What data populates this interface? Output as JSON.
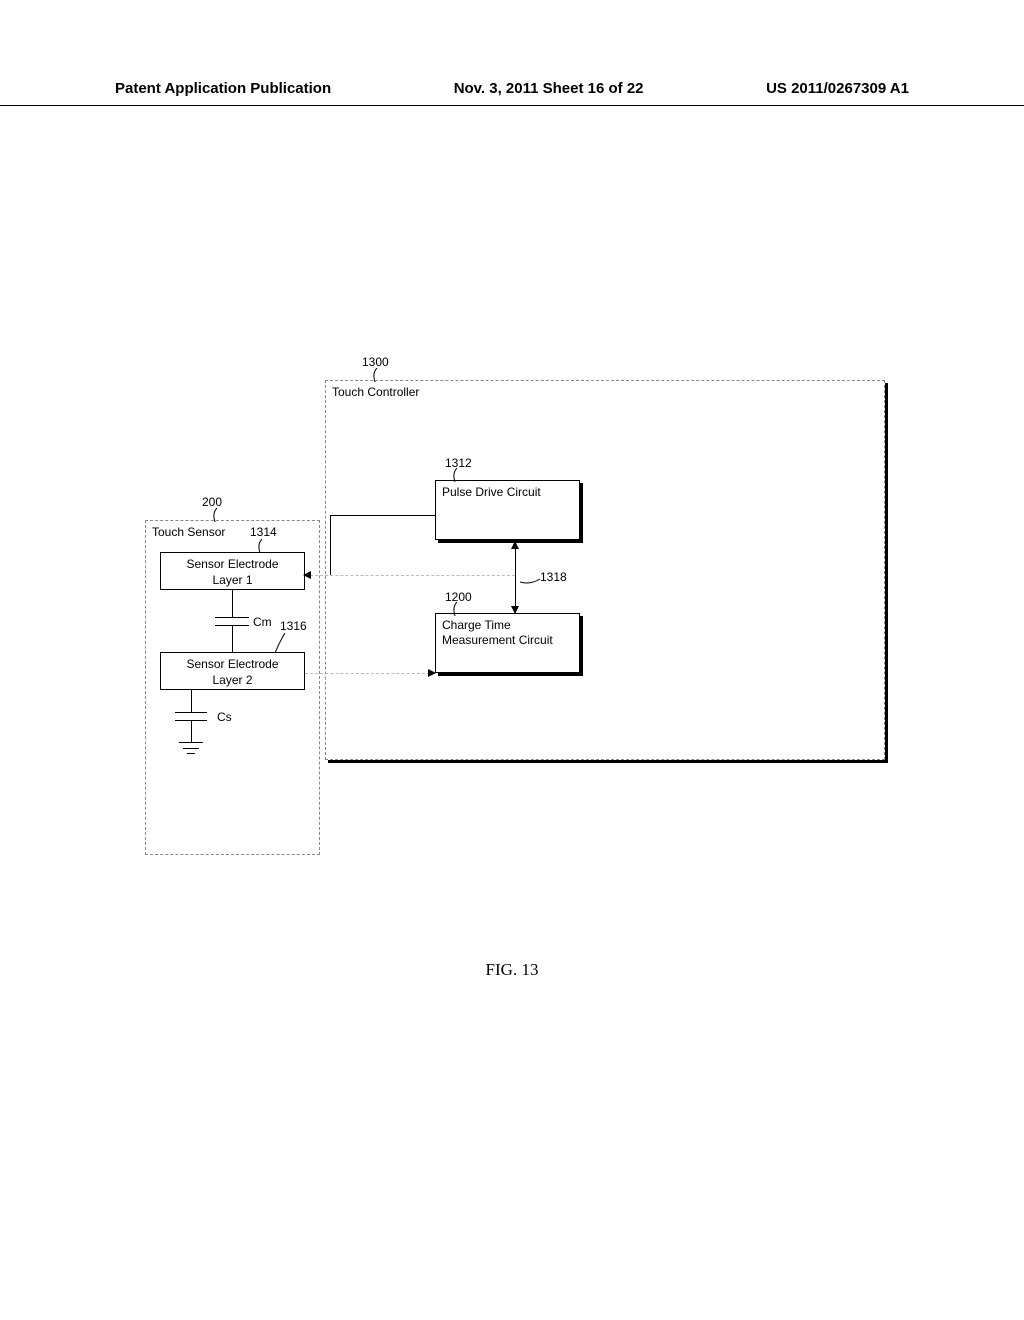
{
  "header": {
    "left": "Patent Application Publication",
    "center": "Nov. 3, 2011   Sheet 16 of 22",
    "right": "US 2011/0267309 A1"
  },
  "figure_label": "FIG. 13",
  "refs": {
    "touch_controller": "1300",
    "touch_sensor": "200",
    "layer1": "1314",
    "layer2": "1316",
    "pulse_drive": "1312",
    "charge_time": "1200",
    "connection": "1318"
  },
  "labels": {
    "touch_controller": "Touch Controller",
    "touch_sensor": "Touch Sensor",
    "sensor_layer1_line1": "Sensor Electrode",
    "sensor_layer1_line2": "Layer 1",
    "sensor_layer2_line1": "Sensor Electrode",
    "sensor_layer2_line2": "Layer 2",
    "cm": "Cm",
    "cs": "Cs",
    "pulse_drive": "Pulse Drive Circuit",
    "charge_time_line1": "Charge Time",
    "charge_time_line2": "Measurement Circuit"
  }
}
